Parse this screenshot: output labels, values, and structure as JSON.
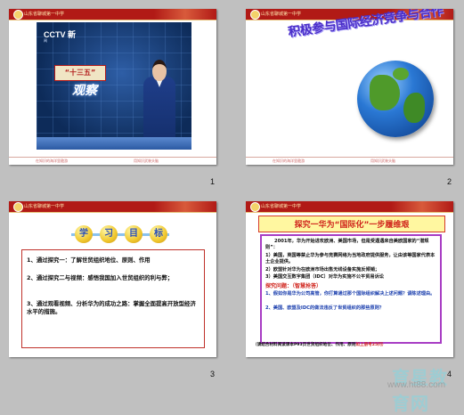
{
  "colors": {
    "background": "#c0c0c0",
    "header_red": "#b11a16",
    "title_purple": "#4b2fc9",
    "title_red": "#d0241c",
    "box_border_purple": "#a83cc4"
  },
  "slides": [
    {
      "number": "1",
      "header_school": "山东省聊城第一中学",
      "footer_left": "在知识的海洋里遨游",
      "footer_right": "用知识武装头脑",
      "cctv_logo": "CCTV 新",
      "cctv_sub": "闻",
      "shisanwu": "“十三五”",
      "guancha": "观察",
      "icons": [
        "tv-studio-image",
        "news-anchor-figure"
      ]
    },
    {
      "number": "2",
      "header_school": "山东省聊城第一中学",
      "title": "积极参与国际经济竞争与合作",
      "footer_left": "在知识的海洋里遨游",
      "footer_right": "用知识武装头脑",
      "icons": [
        "globe-image"
      ]
    },
    {
      "number": "3",
      "header_school": "山东省聊城第一中学",
      "goal_chars": [
        "学",
        "习",
        "目",
        "标"
      ],
      "goals": [
        "1、通过探究一：了解世贸组织地位、原则、作用",
        "2、通过探究二与视频：感悟我国加入世贸组织的利与弊；",
        "3、通过观看视频、分析华为的成功之路：掌握全面提高开放型经济水平的措施。"
      ]
    },
    {
      "number": "4",
      "header_school": "山东省聊城第一中学",
      "title": "探究一华为“国际化”一步履维艰",
      "para_intro": "2001年，华为开始进攻欧洲、美国市场，但是受遇遇来自美欧国家的“潜规则”：",
      "items": [
        "1）美国，英国等禁止华为参与竞赛网络为当地政府提供服务，让由该等国家代表本土企业提供。",
        "2）欧盟针对华为在欧洲市场出售无线设备实施反倾销；",
        "3）美国交互数字集团（IDC）对华为实施不公平贸易诉讼"
      ],
      "question_title": "探究问题：",
      "question_tag": "（智慧抢答）",
      "questions": [
        "1、假如你是华为公司高管，你打算通过那个国际组织解决上述问题？请陈述理由。",
        "2、美国、欧盟及IDC的做法违反了世贸组织的那些原则？"
      ],
      "footer_note": "（请结合材料阅读课本P93页世贸组织地位、作用、原则",
      "footer_note_red": "如上册考25问）"
    }
  ],
  "watermark": {
    "brand": "育星教育网",
    "url": "www.ht88.com"
  }
}
